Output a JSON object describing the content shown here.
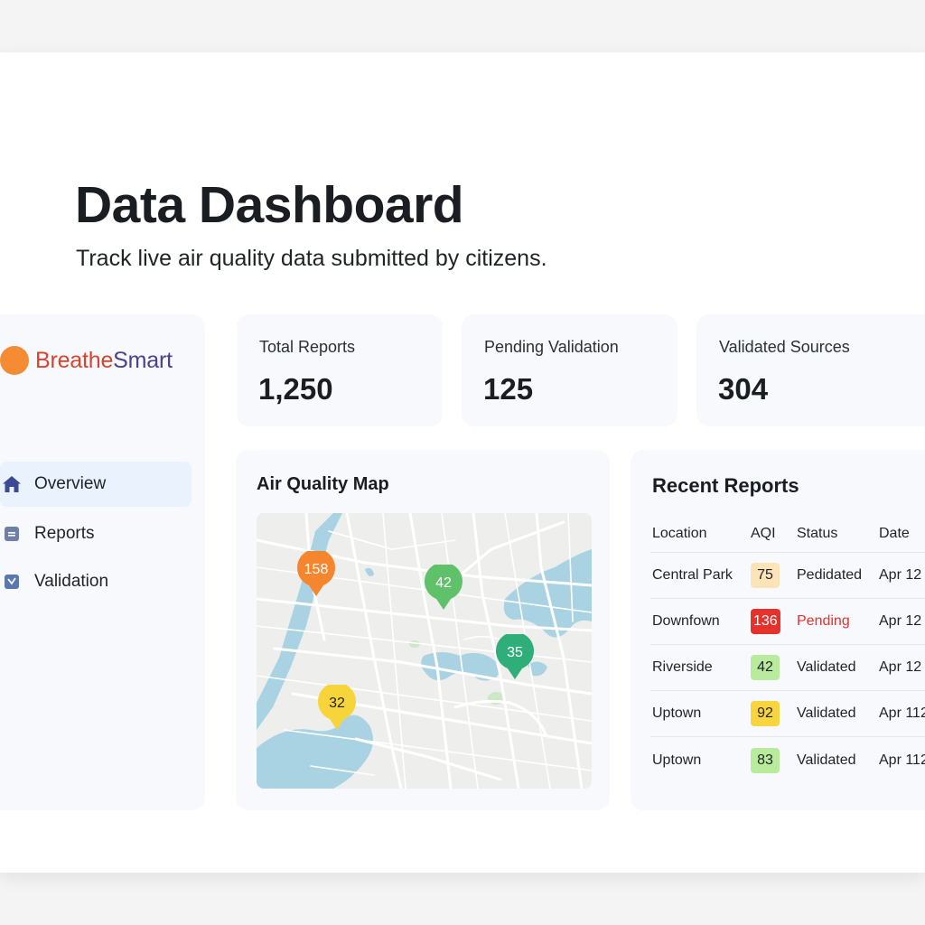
{
  "header": {
    "title": "Data Dashboard",
    "subtitle": "Track live air quality data submitted by citizens."
  },
  "brand": {
    "name_part1": "Breathe",
    "name_part2": "Smart",
    "colors": {
      "dot": "#f58b33",
      "part1": "#d8432e",
      "part2": "#4a3f91"
    }
  },
  "sidebar": {
    "items": [
      {
        "label": "Overview",
        "icon": "home-icon",
        "active": true
      },
      {
        "label": "Reports",
        "icon": "document-icon",
        "active": false
      },
      {
        "label": "Validation",
        "icon": "check-square-icon",
        "active": false
      }
    ]
  },
  "stats": [
    {
      "label": "Total Reports",
      "value": "1,250"
    },
    {
      "label": "Pending Validation",
      "value": "125"
    },
    {
      "label": "Validated Sources",
      "value": "304"
    }
  ],
  "map": {
    "title": "Air Quality Map",
    "markers": [
      {
        "value": "158",
        "color": "#f5862f"
      },
      {
        "value": "42",
        "color": "#5fc26a"
      },
      {
        "value": "35",
        "color": "#2fae7a"
      },
      {
        "value": "32",
        "color": "#f6d43a"
      }
    ]
  },
  "recent_reports": {
    "title": "Recent Reports",
    "columns": [
      "Location",
      "AQI",
      "Status",
      "Date"
    ],
    "rows": [
      {
        "location": "Central Park",
        "aqi": "75",
        "status": "Pedidated",
        "date": "Apr 12"
      },
      {
        "location": "Downfown",
        "aqi": "136",
        "status": "Pending",
        "date": "Apr 12"
      },
      {
        "location": "Riverside",
        "aqi": "42",
        "status": "Validated",
        "date": "Apr 12"
      },
      {
        "location": "Uptown",
        "aqi": "92",
        "status": "Validated",
        "date": "Apr 112"
      },
      {
        "location": "Uptown",
        "aqi": "83",
        "status": "Validated",
        "date": "Apr 112"
      }
    ],
    "colors": {
      "aqi_moderate": "#fde3b8",
      "aqi_unhealthy": "#e5322d",
      "aqi_good": "#b8ec9c",
      "aqi_yellow": "#f8d43e",
      "status_pending": "#e5322d"
    }
  }
}
